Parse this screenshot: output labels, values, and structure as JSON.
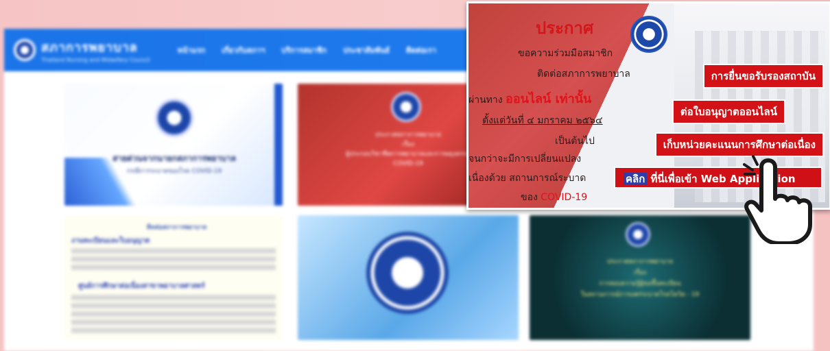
{
  "site": {
    "brand_title": "สภาการพยาบาล",
    "brand_subtitle": "Thailand Nursing and Midwifery Council",
    "nav": [
      "หน้าแรก",
      "เกี่ยวกับสภาฯ",
      "บริการสมาชิก",
      "ประชาสัมพันธ์",
      "ติดต่อเรา"
    ]
  },
  "tiles": {
    "t1_title": "สายด่วนจากนายกสภาการพยาบาล",
    "t1_sub": "กรณีการระบาดของโรค COVID-19",
    "t2_lines": [
      "ประกาศสภาการพยาบาล",
      "เรื่อง",
      "ผู้ประกอบวิชาชีพการพยาบาลและการผดุงครรภ์",
      "COVID-19"
    ],
    "t3_head": "ติดต่อสภาการพยาบาล",
    "t3_title1": "งานทะเบียนและใบอนุญาต",
    "t3_title2": "ศูนย์การศึกษาต่อเนื่องสาขาพยาบาลศาสตร์",
    "t5_lines": [
      "ประกาศสภาการพยาบาล",
      "เรื่อง",
      "การสอบความรู้ผู้ขอขึ้นทะเบียน",
      "ในสถานการณ์การแพร่ระบาดโรคโควิด - 19"
    ]
  },
  "popup": {
    "title": "ประกาศ",
    "line1": "ขอความร่วมมือสมาชิก",
    "line2": "ติดต่อสภาการพยาบาล",
    "line3_prefix": "ผ่านทาง",
    "line3_red": "ออนไลน์ เท่านั้น",
    "line4": "ตั้งแต่วันที่ ๔ มกราคม ๒๕๖๔",
    "line5": "เป็นต้นไป",
    "line6": "จนกว่าจะมีการเปลี่ยนแปลง",
    "line7": "เนื่องด้วย สถานการณ์ระบาด",
    "line8_prefix": "ของ",
    "line8_red": "COVID-19",
    "cta1": "การยื่นขอรับรองสถาบัน",
    "cta2": "ต่อใบอนุญาตออนไลน์",
    "cta3": "เก็บหน่วยคะแนนการศึกษาต่อเนื่อง",
    "cta4_click": "คลิก",
    "cta4_rest": "ที่นี่เพื่อเข้า Web Application"
  },
  "colors": {
    "nav_blue": "#1b74e8",
    "popup_red": "#d21217",
    "accent_blue": "#2d3ea8"
  }
}
